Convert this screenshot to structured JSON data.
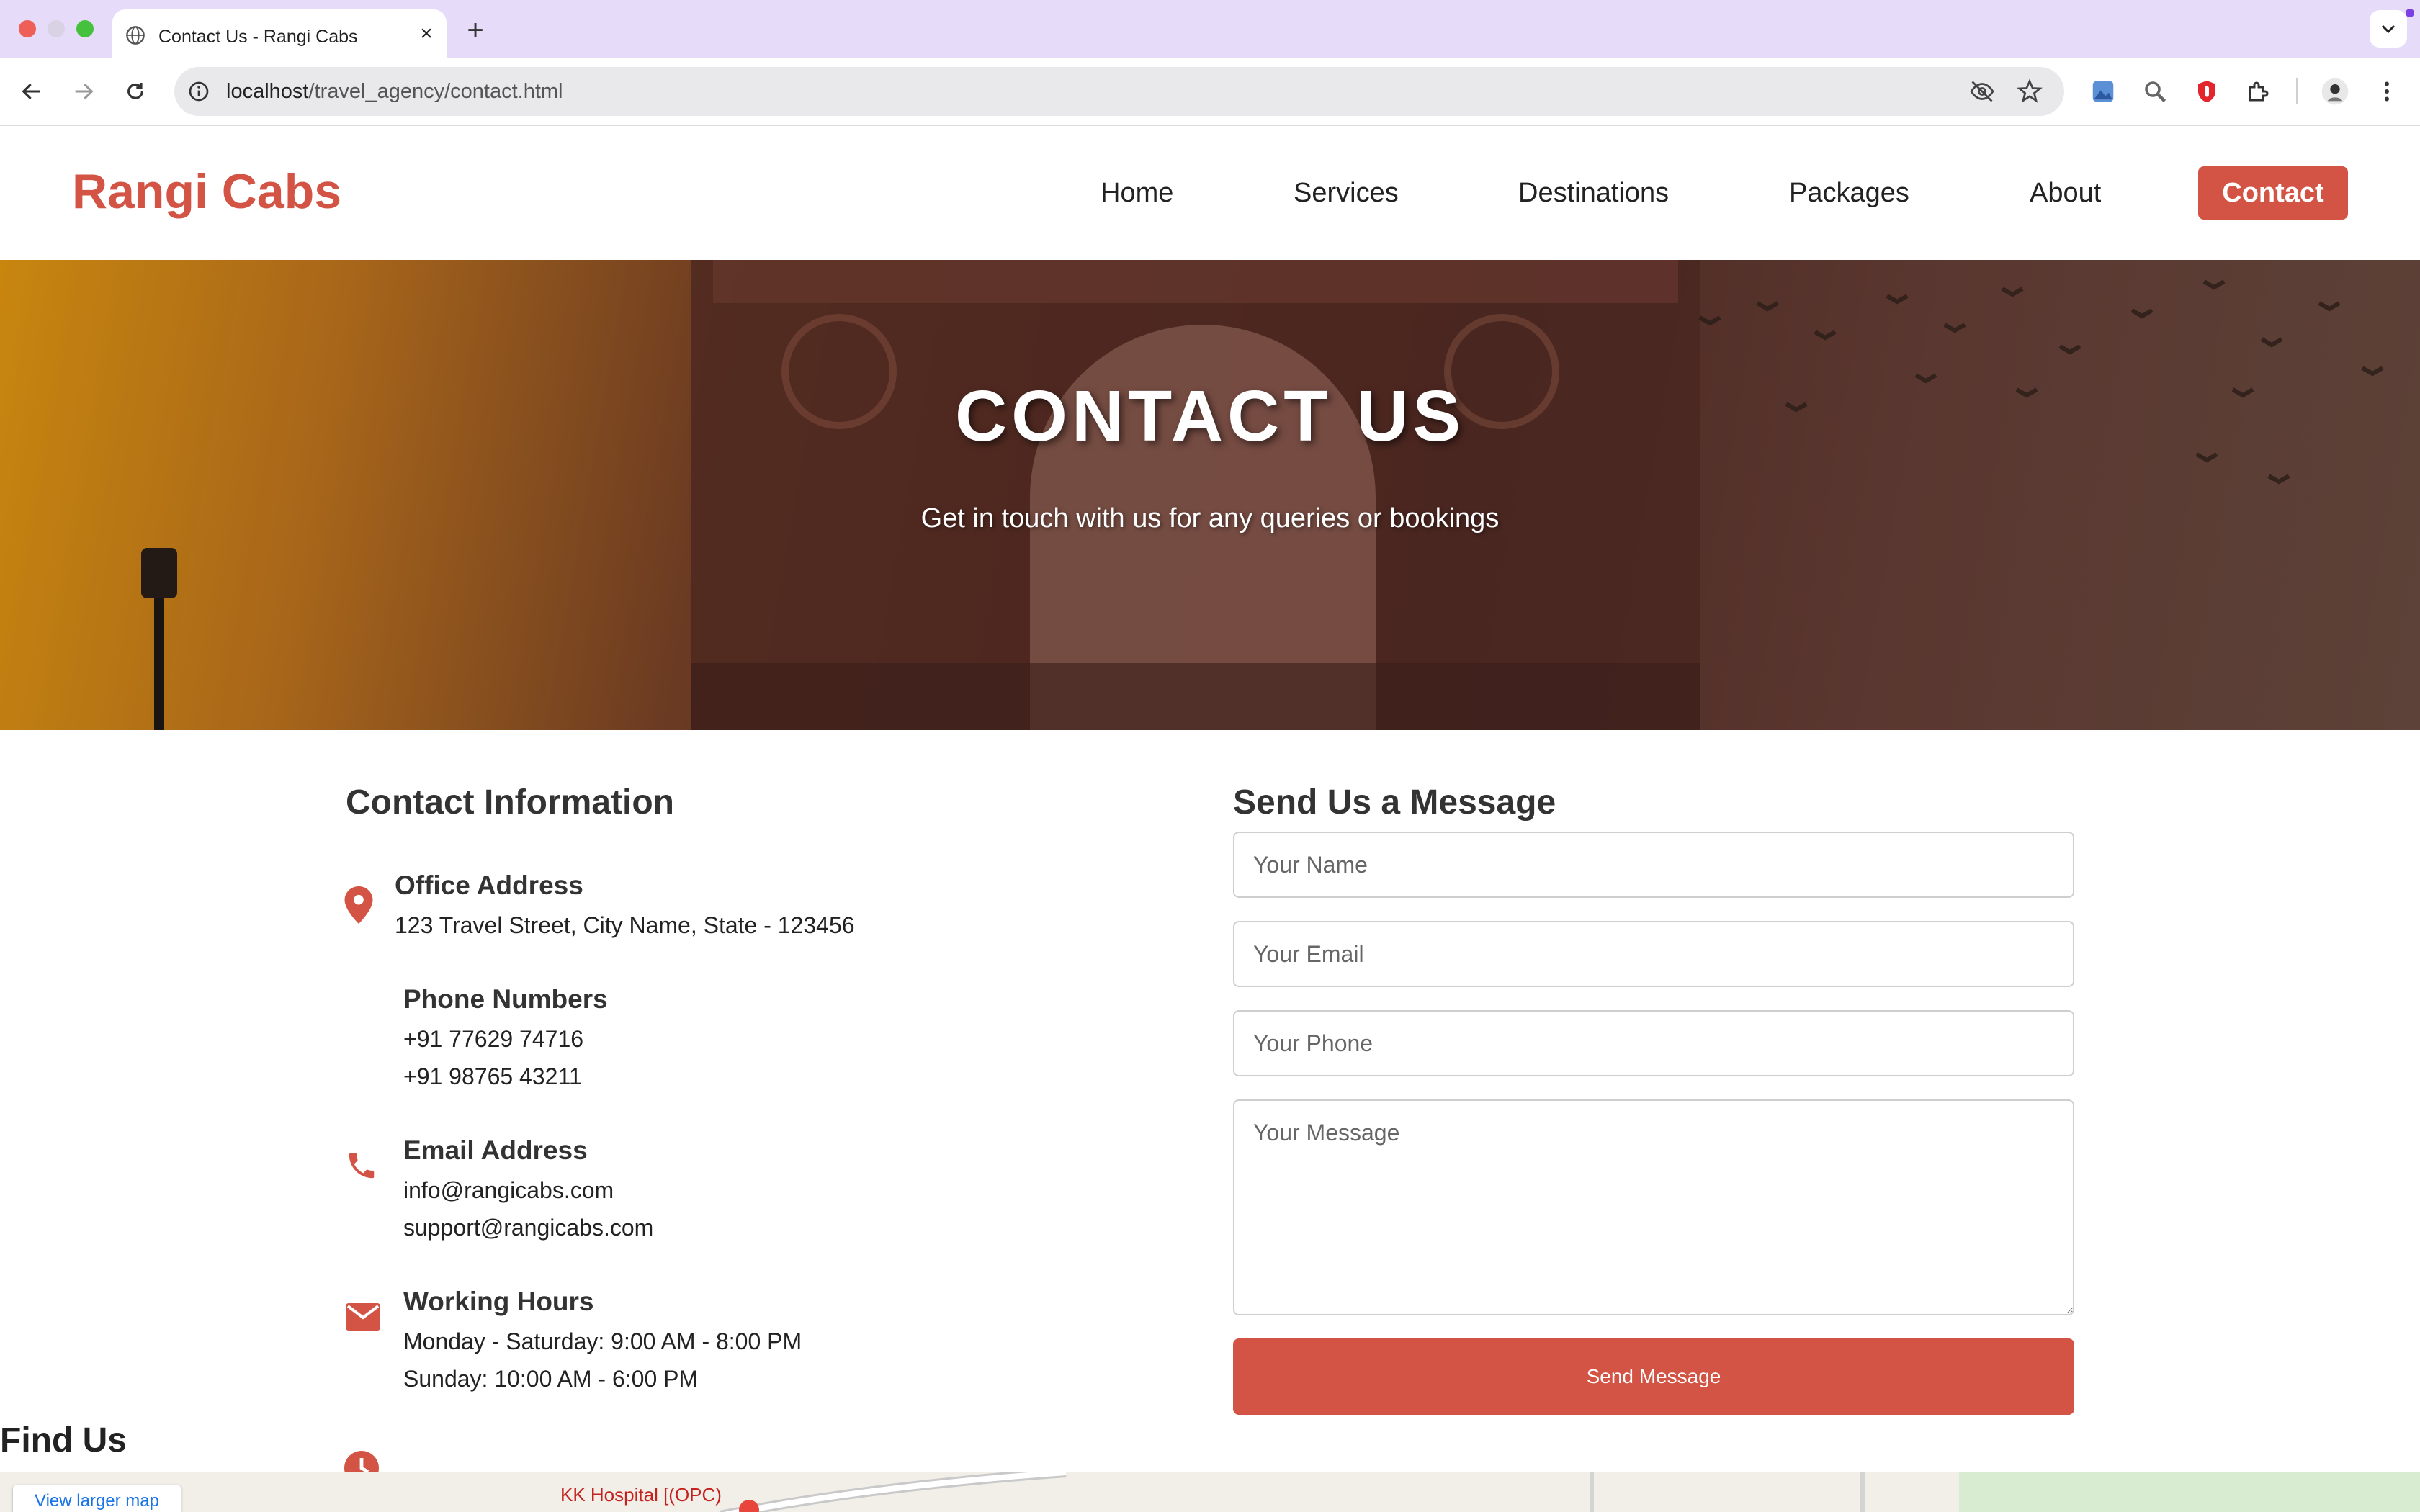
{
  "browser": {
    "tab_title": "Contact Us - Rangi Cabs",
    "url_host": "localhost",
    "url_path": "/travel_agency/contact.html",
    "accent": "#e6dcfa"
  },
  "site": {
    "logo": "Rangi Cabs",
    "brand_color": "#d35444",
    "nav": [
      "Home",
      "Services",
      "Destinations",
      "Packages",
      "About",
      "Contact"
    ],
    "active_nav": "Contact"
  },
  "hero": {
    "title": "CONTACT US",
    "subtitle": "Get in touch with us for any queries or bookings"
  },
  "contact_info": {
    "heading": "Contact Information",
    "items": [
      {
        "icon": "map-pin-icon",
        "title": "Office Address",
        "lines": [
          "123 Travel Street, City Name, State - 123456"
        ]
      },
      {
        "icon": "phone-icon",
        "title": "Phone Numbers",
        "lines": [
          "+91 77629 74716",
          "+91 98765 43211"
        ]
      },
      {
        "icon": "envelope-icon",
        "title": "Email Address",
        "lines": [
          "info@rangicabs.com",
          "support@rangicabs.com"
        ]
      },
      {
        "icon": "clock-icon",
        "title": "Working Hours",
        "lines": [
          "Monday - Saturday: 9:00 AM - 8:00 PM",
          "Sunday: 10:00 AM - 6:00 PM"
        ]
      }
    ]
  },
  "form": {
    "heading": "Send Us a Message",
    "name_placeholder": "Your Name",
    "email_placeholder": "Your Email",
    "phone_placeholder": "Your Phone",
    "message_placeholder": "Your Message",
    "submit_label": "Send Message"
  },
  "map": {
    "heading": "Find Us",
    "larger_map_label": "View larger map",
    "visible_place": "KK Hospital [(OPC)"
  }
}
